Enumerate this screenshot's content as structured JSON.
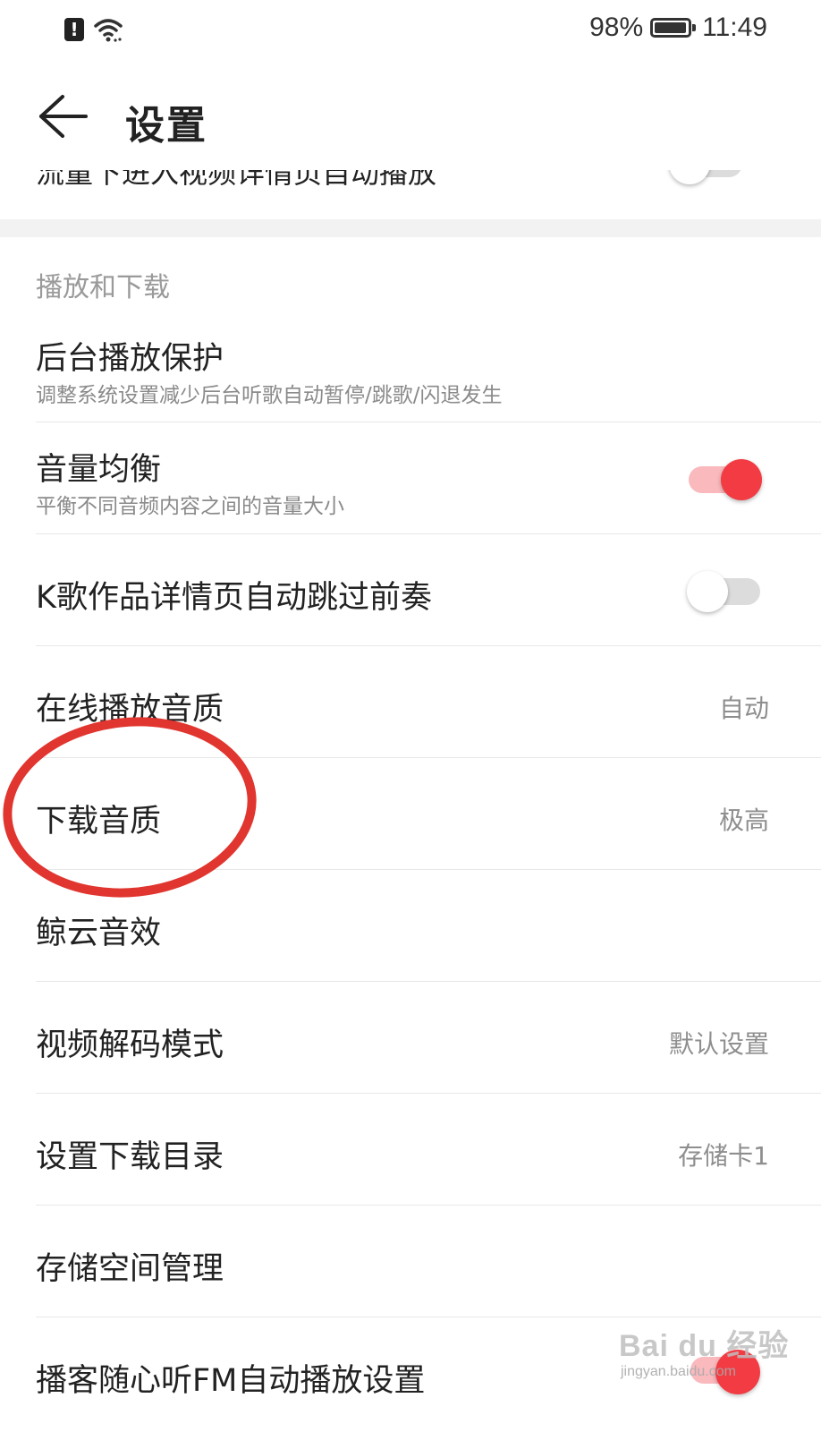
{
  "status_bar": {
    "battery": "98%",
    "time": "11:49"
  },
  "header": {
    "title": "设置"
  },
  "prev_row": {
    "label": "流量下进入视频详情页自动播放"
  },
  "section": {
    "title": "播放和下载"
  },
  "rows": {
    "background_protect": {
      "label": "后台播放保护",
      "desc": "调整系统设置减少后台听歌自动暂停/跳歌/闪退发生"
    },
    "volume_balance": {
      "label": "音量均衡",
      "desc": "平衡不同音频内容之间的音量大小",
      "toggle": "on"
    },
    "k_song_skip": {
      "label": "K歌作品详情页自动跳过前奏",
      "toggle": "off"
    },
    "online_quality": {
      "label": "在线播放音质",
      "value": "自动"
    },
    "download_quality": {
      "label": "下载音质",
      "value": "极高"
    },
    "whale_effects": {
      "label": "鲸云音效"
    },
    "video_decode": {
      "label": "视频解码模式",
      "value": "默认设置"
    },
    "download_dir": {
      "label": "设置下载目录",
      "value": "存储卡1"
    },
    "storage_mgmt": {
      "label": "存储空间管理"
    },
    "podcast_fm": {
      "label": "播客随心听FM自动播放设置"
    }
  },
  "watermark": {
    "brand": "Bai du 经验",
    "url": "jingyan.baidu.com"
  },
  "colors": {
    "accent": "#f23b43",
    "accent_light": "#f9b9bd",
    "annotation": "#e1352f"
  }
}
